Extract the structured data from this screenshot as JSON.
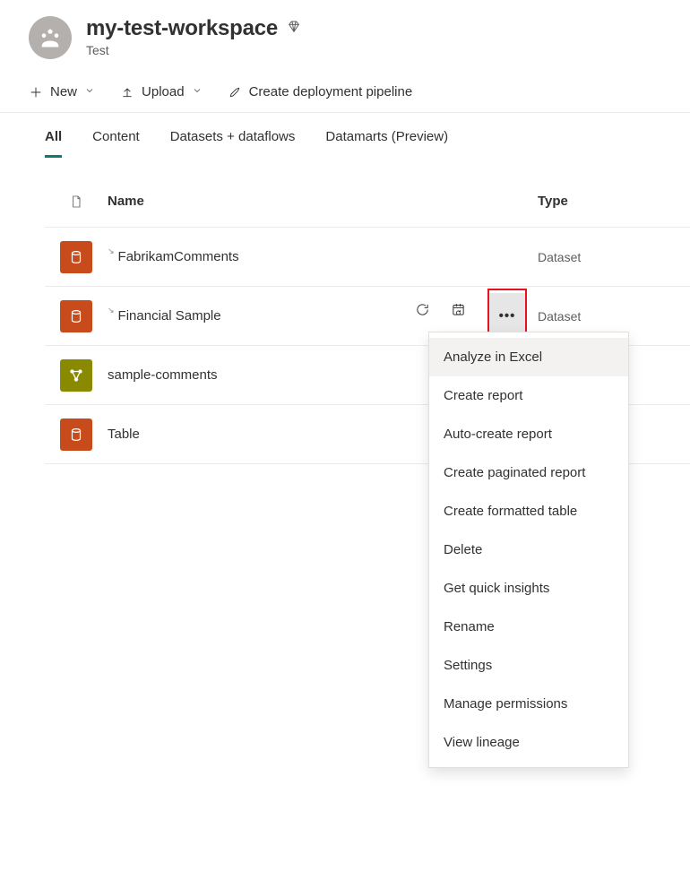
{
  "workspace": {
    "title": "my-test-workspace",
    "subtitle": "Test"
  },
  "toolbar": {
    "new": "New",
    "upload": "Upload",
    "pipeline": "Create deployment pipeline"
  },
  "tabs": {
    "all": "All",
    "content": "Content",
    "datasets": "Datasets + dataflows",
    "datamarts": "Datamarts (Preview)"
  },
  "columns": {
    "name": "Name",
    "type": "Type"
  },
  "items": [
    {
      "name": "FabrikamComments",
      "type": "Dataset",
      "iconColor": "orange",
      "kind": "dataset"
    },
    {
      "name": "Financial Sample",
      "type": "Dataset",
      "iconColor": "orange",
      "kind": "dataset"
    },
    {
      "name": "sample-comments",
      "type": "",
      "iconColor": "olive",
      "kind": "dataflow"
    },
    {
      "name": "Table",
      "type": "",
      "iconColor": "orange",
      "kind": "dataset"
    }
  ],
  "menu": {
    "items": [
      "Analyze in Excel",
      "Create report",
      "Auto-create report",
      "Create paginated report",
      "Create formatted table",
      "Delete",
      "Get quick insights",
      "Rename",
      "Settings",
      "Manage permissions",
      "View lineage"
    ]
  }
}
